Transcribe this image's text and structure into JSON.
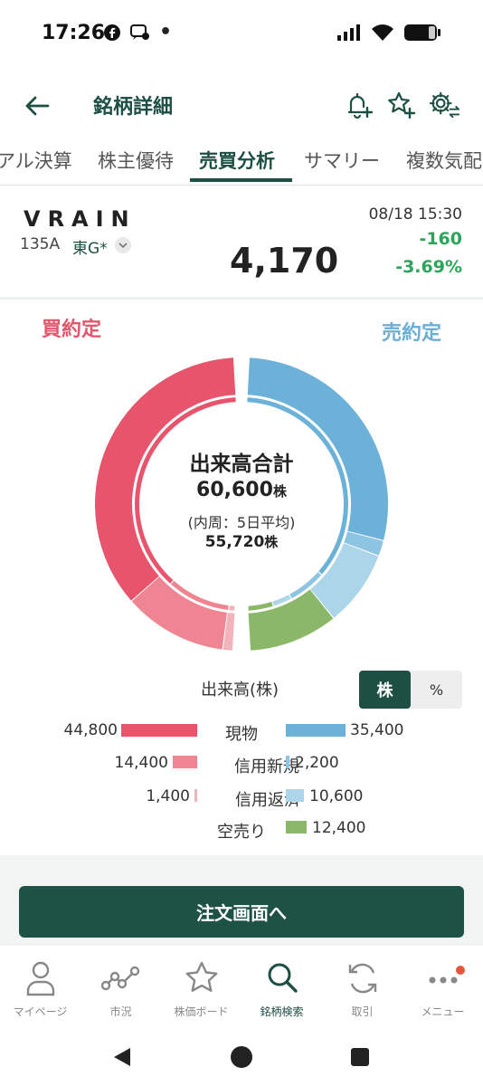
{
  "status_bar": {
    "time": "17:26"
  },
  "header": {
    "title": "銘柄詳細"
  },
  "tabs": [
    {
      "label": "アル決算"
    },
    {
      "label": "株主優待"
    },
    {
      "label": "売買分析"
    },
    {
      "label": "サマリー"
    },
    {
      "label": "複数気配"
    }
  ],
  "stock": {
    "name": "VRAIN",
    "code": "135A",
    "market": "東G*",
    "price": "4,170",
    "datetime": "08/18 15:30",
    "change": "-160",
    "change_pct": "-3.69%"
  },
  "chart": {
    "buy_label": "買約定",
    "sell_label": "売約定",
    "center_title": "出来高合計",
    "total": "60,600",
    "total_unit": "株",
    "note": "(内周：5日平均)",
    "avg": "55,720",
    "avg_unit": "株"
  },
  "legend": {
    "title": "出来高(株)",
    "toggle_share": "株",
    "toggle_pct": "%",
    "rows": [
      {
        "label": "現物",
        "buy": "44,800",
        "sell": "35,400"
      },
      {
        "label": "信用新規",
        "buy": "14,400",
        "sell": "2,200"
      },
      {
        "label": "信用返済",
        "buy": "1,400",
        "sell": "10,600"
      },
      {
        "label": "空売り",
        "buy": "",
        "sell": "12,400"
      }
    ]
  },
  "chart_data": {
    "type": "pie",
    "title": "出来高合計",
    "total": 60600,
    "inner_ring_avg": 55720,
    "colors": {
      "buy_cash": "#e8546b",
      "buy_margin_new": "#ef8593",
      "buy_margin_repay": "#f3b3bb",
      "sell_cash": "#6bb1d8",
      "sell_margin_new": "#8cc4e2",
      "sell_margin_repay": "#acd5ea",
      "short_sell": "#8ab868"
    },
    "buy": [
      {
        "name": "現物",
        "value": 44800
      },
      {
        "name": "信用新規",
        "value": 14400
      },
      {
        "name": "信用返済",
        "value": 1400
      }
    ],
    "sell": [
      {
        "name": "現物",
        "value": 35400
      },
      {
        "name": "信用新規",
        "value": 2200
      },
      {
        "name": "信用返済",
        "value": 10600
      },
      {
        "name": "空売り",
        "value": 12400
      }
    ]
  },
  "order_button": {
    "label": "注文画面へ"
  },
  "bottom_nav": [
    {
      "label": "マイページ",
      "icon": "person-icon"
    },
    {
      "label": "市況",
      "icon": "market-graph-icon"
    },
    {
      "label": "株価ボード",
      "icon": "star-icon"
    },
    {
      "label": "銘柄検索",
      "icon": "search-icon"
    },
    {
      "label": "取引",
      "icon": "refresh-icon"
    },
    {
      "label": "メニュー",
      "icon": "more-icon"
    }
  ]
}
